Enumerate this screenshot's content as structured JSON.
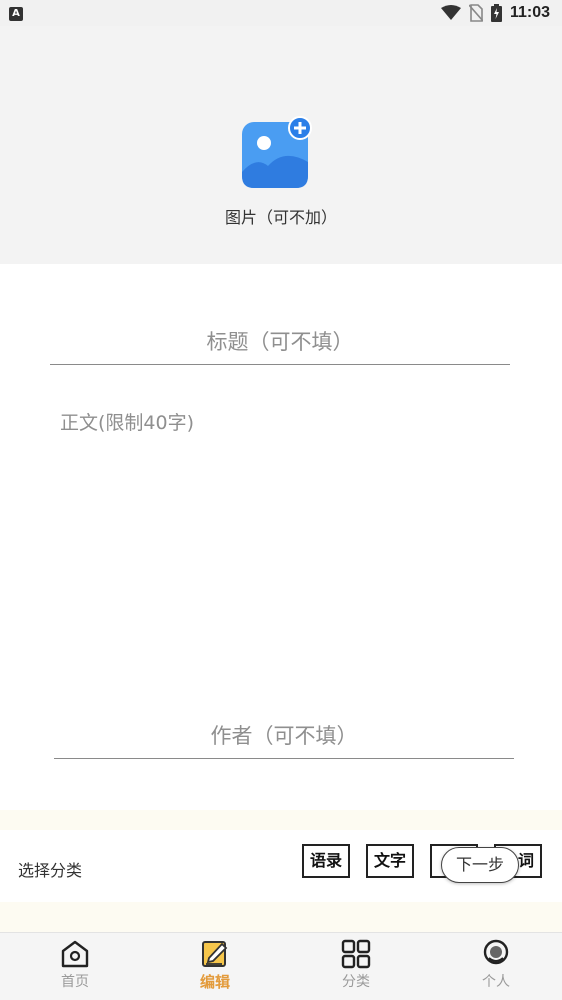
{
  "status_bar": {
    "app_icon": "A",
    "time": "11:03"
  },
  "image_picker": {
    "label": "图片（可不加）",
    "icon": "image-add-icon"
  },
  "form": {
    "title_placeholder": "标题（可不填）",
    "body_placeholder": "正文(限制40字)",
    "author_placeholder": "作者（可不填）"
  },
  "category": {
    "label": "选择分类",
    "options": [
      "语录",
      "文字",
      "",
      "词"
    ],
    "next_label": "下一步"
  },
  "nav": {
    "items": [
      {
        "label": "首页",
        "icon": "home-icon"
      },
      {
        "label": "编辑",
        "icon": "edit-icon",
        "active": true
      },
      {
        "label": "分类",
        "icon": "grid-icon"
      },
      {
        "label": "个人",
        "icon": "person-icon"
      }
    ]
  },
  "colors": {
    "accent": "#e39b3c",
    "image_blue": "#3d8ff0"
  }
}
